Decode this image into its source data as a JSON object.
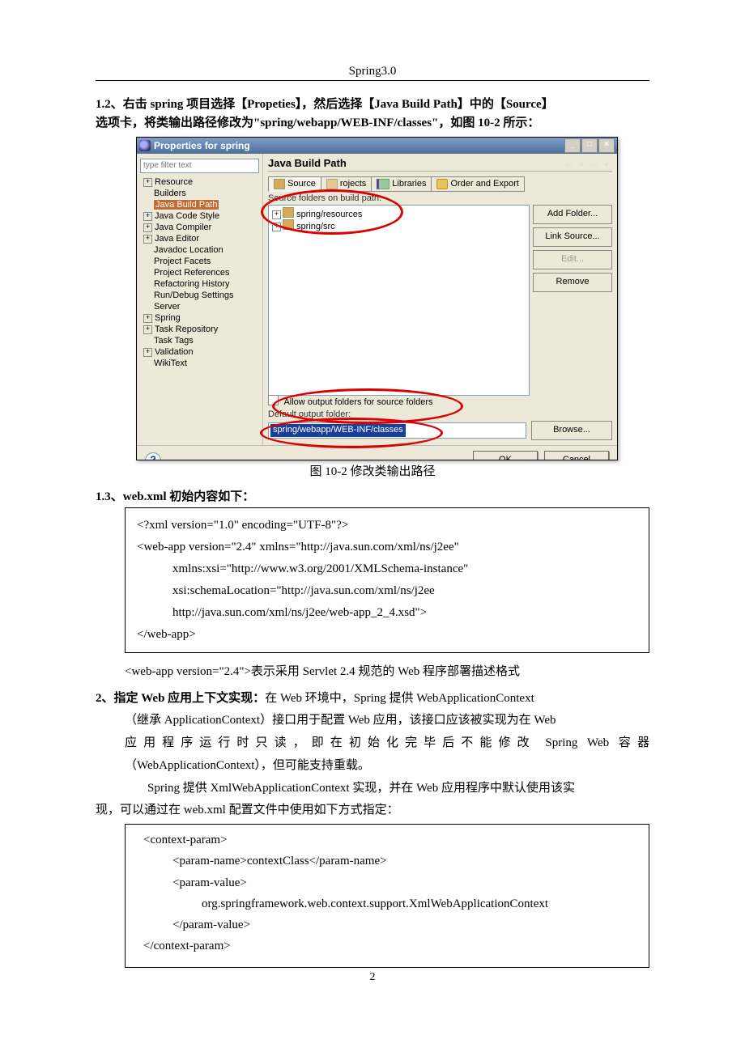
{
  "header": {
    "title": "Spring3.0"
  },
  "sec12": {
    "text_a": "1.2、右击 spring 项目选择【Propeties】，然后选择【Java Build Path】中的【Source】",
    "text_b": "选项卡，将类输出路径修改为\"spring/webapp/WEB-INF/classes\"，如图 10-2 所示："
  },
  "dialog": {
    "title": "Properties for spring",
    "win": {
      "min": "_",
      "max": "□",
      "close": "×"
    },
    "filter_placeholder": "type filter text",
    "tree": {
      "items": [
        {
          "exp": "+",
          "label": "Resource"
        },
        {
          "exp": "",
          "label": "Builders"
        },
        {
          "exp": "",
          "label": "Java Build Path",
          "selected": true
        },
        {
          "exp": "+",
          "label": "Java Code Style"
        },
        {
          "exp": "+",
          "label": "Java Compiler"
        },
        {
          "exp": "+",
          "label": "Java Editor"
        },
        {
          "exp": "",
          "label": "Javadoc Location"
        },
        {
          "exp": "",
          "label": "Project Facets"
        },
        {
          "exp": "",
          "label": "Project References"
        },
        {
          "exp": "",
          "label": "Refactoring History"
        },
        {
          "exp": "",
          "label": "Run/Debug Settings"
        },
        {
          "exp": "",
          "label": "Server"
        },
        {
          "exp": "+",
          "label": "Spring"
        },
        {
          "exp": "+",
          "label": "Task Repository"
        },
        {
          "exp": "",
          "label": "Task Tags"
        },
        {
          "exp": "+",
          "label": "Validation"
        },
        {
          "exp": "",
          "label": "WikiText"
        }
      ]
    },
    "panel_title": "Java Build Path",
    "nav": "⇦ ▾ ⇨ ▾",
    "tabs": {
      "source": "Source",
      "projects": "rojects",
      "libraries": "Libraries",
      "order": "Order and Export"
    },
    "src_label": "Source folders on build path:",
    "src_entries": [
      "spring/resources",
      "spring/src"
    ],
    "buttons": {
      "add_folder": "Add Folder...",
      "link_source": "Link Source...",
      "edit": "Edit...",
      "remove": "Remove",
      "browse": "Browse...",
      "ok": "OK",
      "cancel": "Cancel"
    },
    "allow_label": "Allow output folders for source folders",
    "out_label": "Default output folder:",
    "out_value": "spring/webapp/WEB-INF/classes"
  },
  "caption": "图 10-2  修改类输出路径",
  "sec13": {
    "heading": "1.3、web.xml 初始内容如下：",
    "code": {
      "l1": "<?xml version=\"1.0\" encoding=\"UTF-8\"?>",
      "l2": "<web-app version=\"2.4\" xmlns=\"http://java.sun.com/xml/ns/j2ee\"",
      "l3": "xmlns:xsi=\"http://www.w3.org/2001/XMLSchema-instance\"",
      "l4": "xsi:schemaLocation=\"http://java.sun.com/xml/ns/j2ee",
      "l5": "http://java.sun.com/xml/ns/j2ee/web-app_2_4.xsd\">",
      "l6": "</web-app>"
    },
    "explain": "<web-app version=\"2.4\">表示采用 Servlet 2.4 规范的 Web 程序部署描述格式"
  },
  "sec2": {
    "line1_a": "2、指定 Web 应用上下文实现：",
    "line1_b": "在 Web 环境中，Spring 提供 WebApplicationContext",
    "line2": "（继承 ApplicationContext）接口用于配置 Web 应用，该接口应该被实现为在 Web",
    "line3": "应用程序运行时只读，即在初始化完毕后不能修改 Spring Web 容器",
    "line4": "（WebApplicationContext），但可能支持重载。",
    "line5": "Spring 提供 XmlWebApplicationContext 实现，并在 Web 应用程序中默认使用该实",
    "line6": "现，可以通过在 web.xml 配置文件中使用如下方式指定："
  },
  "code2": {
    "l1": "<context-param>",
    "l2": "<param-name>contextClass</param-name>",
    "l3": "<param-value>",
    "l4": "org.springframework.web.context.support.XmlWebApplicationContext",
    "l5": "</param-value>",
    "l6": "</context-param>"
  },
  "pagenum": "2"
}
